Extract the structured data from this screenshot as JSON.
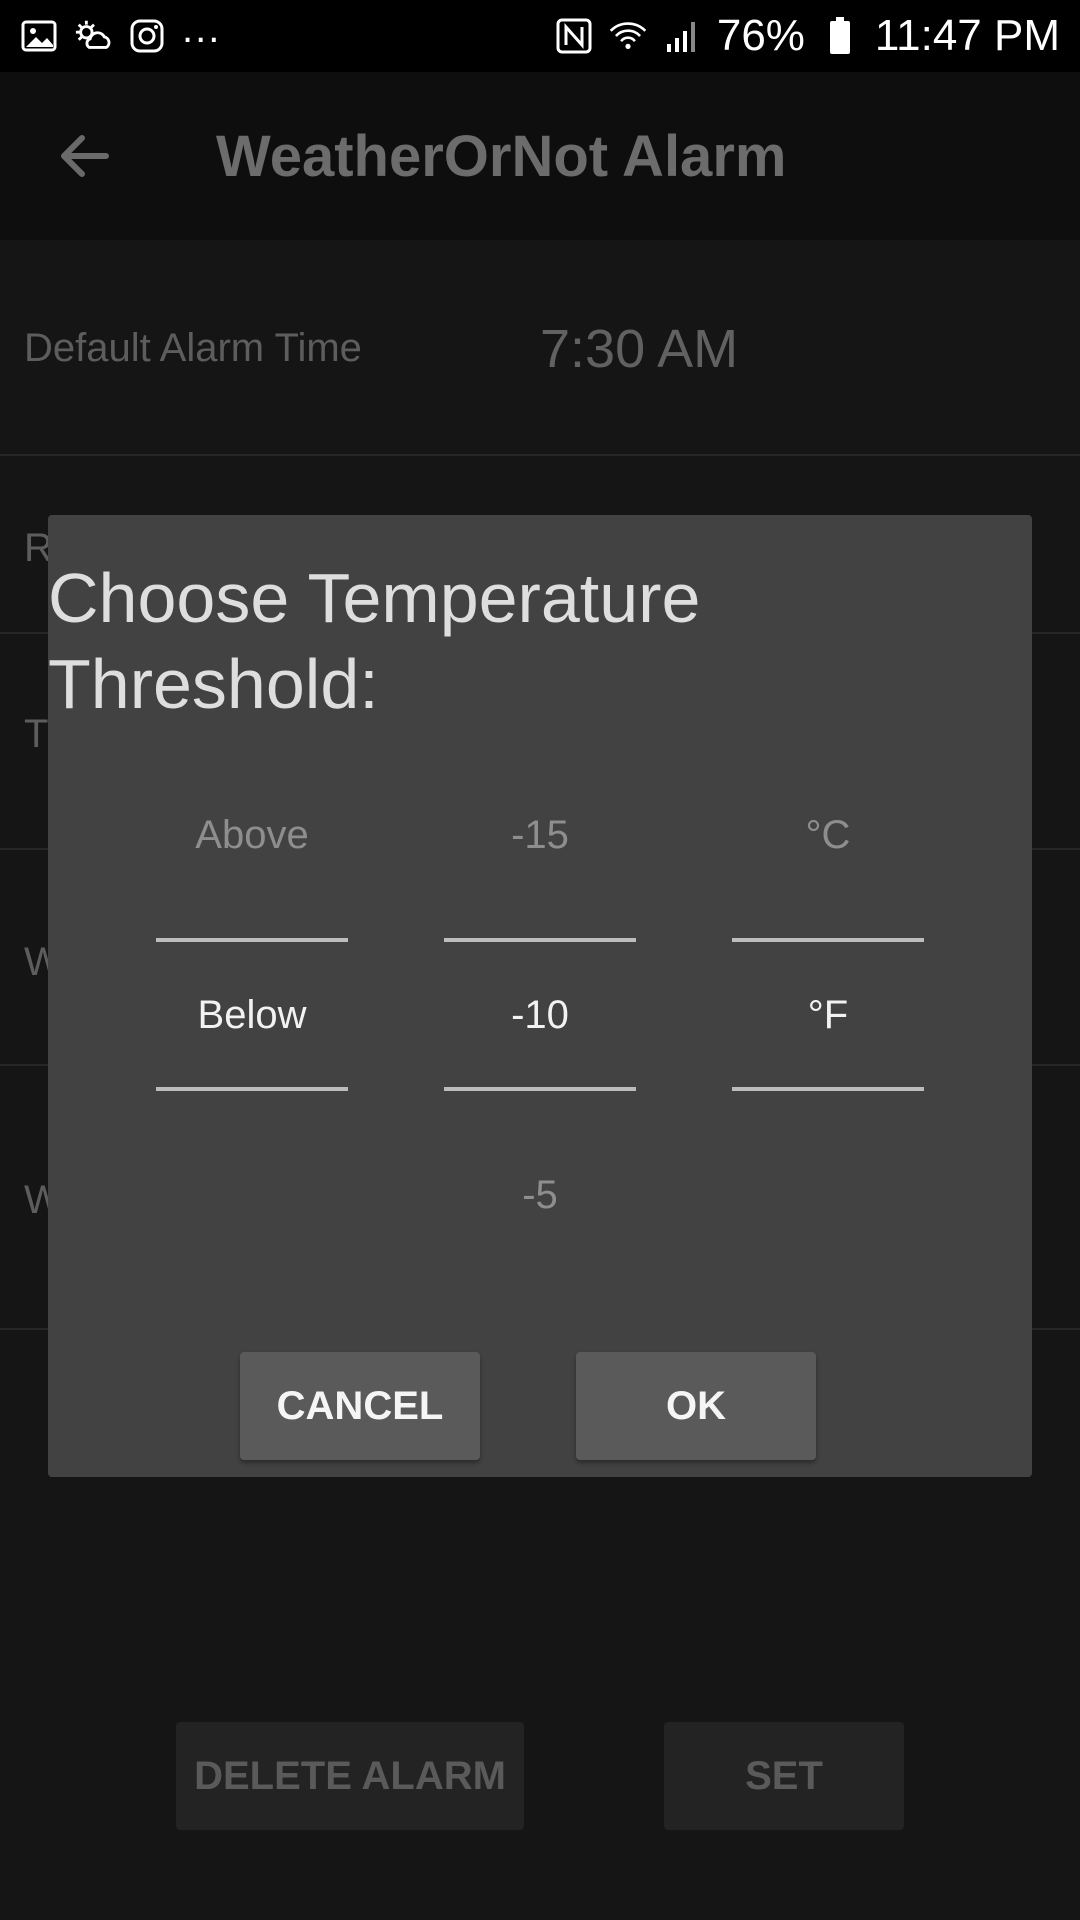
{
  "status_bar": {
    "icons_left": [
      "gallery-icon",
      "weather-icon",
      "instagram-icon"
    ],
    "more": "...",
    "icons_right": [
      "nfc-icon",
      "wifi-icon",
      "signal-icon"
    ],
    "battery": "76%",
    "time": "11:47 PM"
  },
  "app_bar": {
    "title": "WeatherOrNot Alarm"
  },
  "settings": {
    "default_alarm_time_label": "Default Alarm Time",
    "default_alarm_time_value": "7:30 AM",
    "row2_initial": "R",
    "row3_initial": "T",
    "row4_initial": "W",
    "row5_initial": "W"
  },
  "bottom": {
    "delete_label": "DELETE ALARM",
    "set_label": "SET"
  },
  "dialog": {
    "title": "Choose Temperature Threshold:",
    "direction": {
      "prev": "Above",
      "selected": "Below",
      "next": ""
    },
    "value": {
      "prev": "-15",
      "selected": "-10",
      "next": "-5"
    },
    "unit": {
      "prev": "°C",
      "selected": "°F",
      "next": ""
    },
    "cancel_label": "CANCEL",
    "ok_label": "OK"
  },
  "colors": {
    "dialog_bg": "#424242",
    "screen_bg": "#151515",
    "divider": "#bdbdbd"
  }
}
